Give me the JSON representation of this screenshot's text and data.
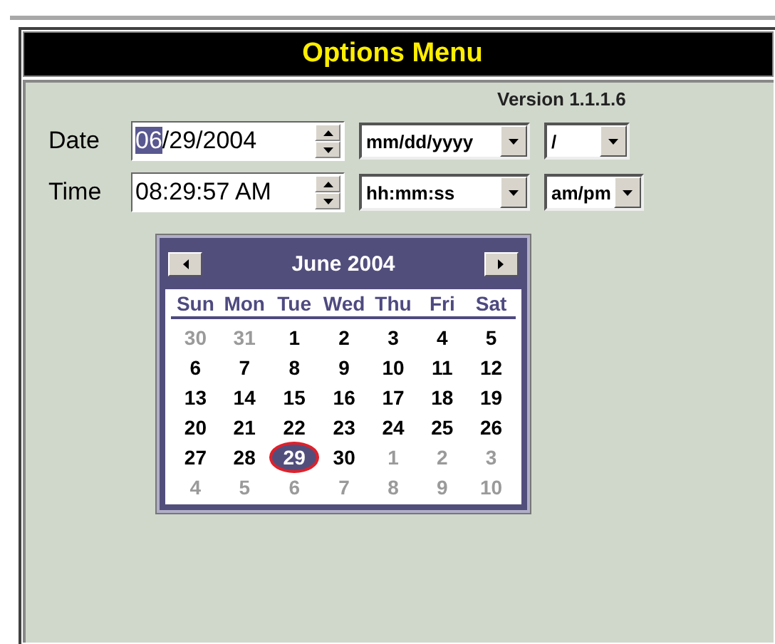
{
  "window": {
    "title": "Options Menu"
  },
  "version": "Version 1.1.1.6",
  "rows": [
    {
      "label": "Date",
      "value_parts": [
        {
          "text": "06",
          "selected": true
        },
        {
          "text": "/29/2004",
          "selected": false
        }
      ],
      "format": "mm/dd/yyyy",
      "separator": "/"
    },
    {
      "label": "Time",
      "value_parts": [
        {
          "text": "08:29:57 AM",
          "selected": false
        }
      ],
      "format": "hh:mm:ss",
      "separator": "am/pm"
    }
  ],
  "calendar": {
    "title": "June 2004",
    "weekdays": [
      "Sun",
      "Mon",
      "Tue",
      "Wed",
      "Thu",
      "Fri",
      "Sat"
    ],
    "weeks": [
      [
        {
          "day": "30",
          "other_month": true,
          "selected": false
        },
        {
          "day": "31",
          "other_month": true,
          "selected": false
        },
        {
          "day": "1",
          "other_month": false,
          "selected": false
        },
        {
          "day": "2",
          "other_month": false,
          "selected": false
        },
        {
          "day": "3",
          "other_month": false,
          "selected": false
        },
        {
          "day": "4",
          "other_month": false,
          "selected": false
        },
        {
          "day": "5",
          "other_month": false,
          "selected": false
        }
      ],
      [
        {
          "day": "6",
          "other_month": false,
          "selected": false
        },
        {
          "day": "7",
          "other_month": false,
          "selected": false
        },
        {
          "day": "8",
          "other_month": false,
          "selected": false
        },
        {
          "day": "9",
          "other_month": false,
          "selected": false
        },
        {
          "day": "10",
          "other_month": false,
          "selected": false
        },
        {
          "day": "11",
          "other_month": false,
          "selected": false
        },
        {
          "day": "12",
          "other_month": false,
          "selected": false
        }
      ],
      [
        {
          "day": "13",
          "other_month": false,
          "selected": false
        },
        {
          "day": "14",
          "other_month": false,
          "selected": false
        },
        {
          "day": "15",
          "other_month": false,
          "selected": false
        },
        {
          "day": "16",
          "other_month": false,
          "selected": false
        },
        {
          "day": "17",
          "other_month": false,
          "selected": false
        },
        {
          "day": "18",
          "other_month": false,
          "selected": false
        },
        {
          "day": "19",
          "other_month": false,
          "selected": false
        }
      ],
      [
        {
          "day": "20",
          "other_month": false,
          "selected": false
        },
        {
          "day": "21",
          "other_month": false,
          "selected": false
        },
        {
          "day": "22",
          "other_month": false,
          "selected": false
        },
        {
          "day": "23",
          "other_month": false,
          "selected": false
        },
        {
          "day": "24",
          "other_month": false,
          "selected": false
        },
        {
          "day": "25",
          "other_month": false,
          "selected": false
        },
        {
          "day": "26",
          "other_month": false,
          "selected": false
        }
      ],
      [
        {
          "day": "27",
          "other_month": false,
          "selected": false
        },
        {
          "day": "28",
          "other_month": false,
          "selected": false
        },
        {
          "day": "29",
          "other_month": false,
          "selected": true
        },
        {
          "day": "30",
          "other_month": false,
          "selected": false
        },
        {
          "day": "1",
          "other_month": true,
          "selected": false
        },
        {
          "day": "2",
          "other_month": true,
          "selected": false
        },
        {
          "day": "3",
          "other_month": true,
          "selected": false
        }
      ],
      [
        {
          "day": "4",
          "other_month": true,
          "selected": false
        },
        {
          "day": "5",
          "other_month": true,
          "selected": false
        },
        {
          "day": "6",
          "other_month": true,
          "selected": false
        },
        {
          "day": "7",
          "other_month": true,
          "selected": false
        },
        {
          "day": "8",
          "other_month": true,
          "selected": false
        },
        {
          "day": "9",
          "other_month": true,
          "selected": false
        },
        {
          "day": "10",
          "other_month": true,
          "selected": false
        }
      ]
    ]
  }
}
